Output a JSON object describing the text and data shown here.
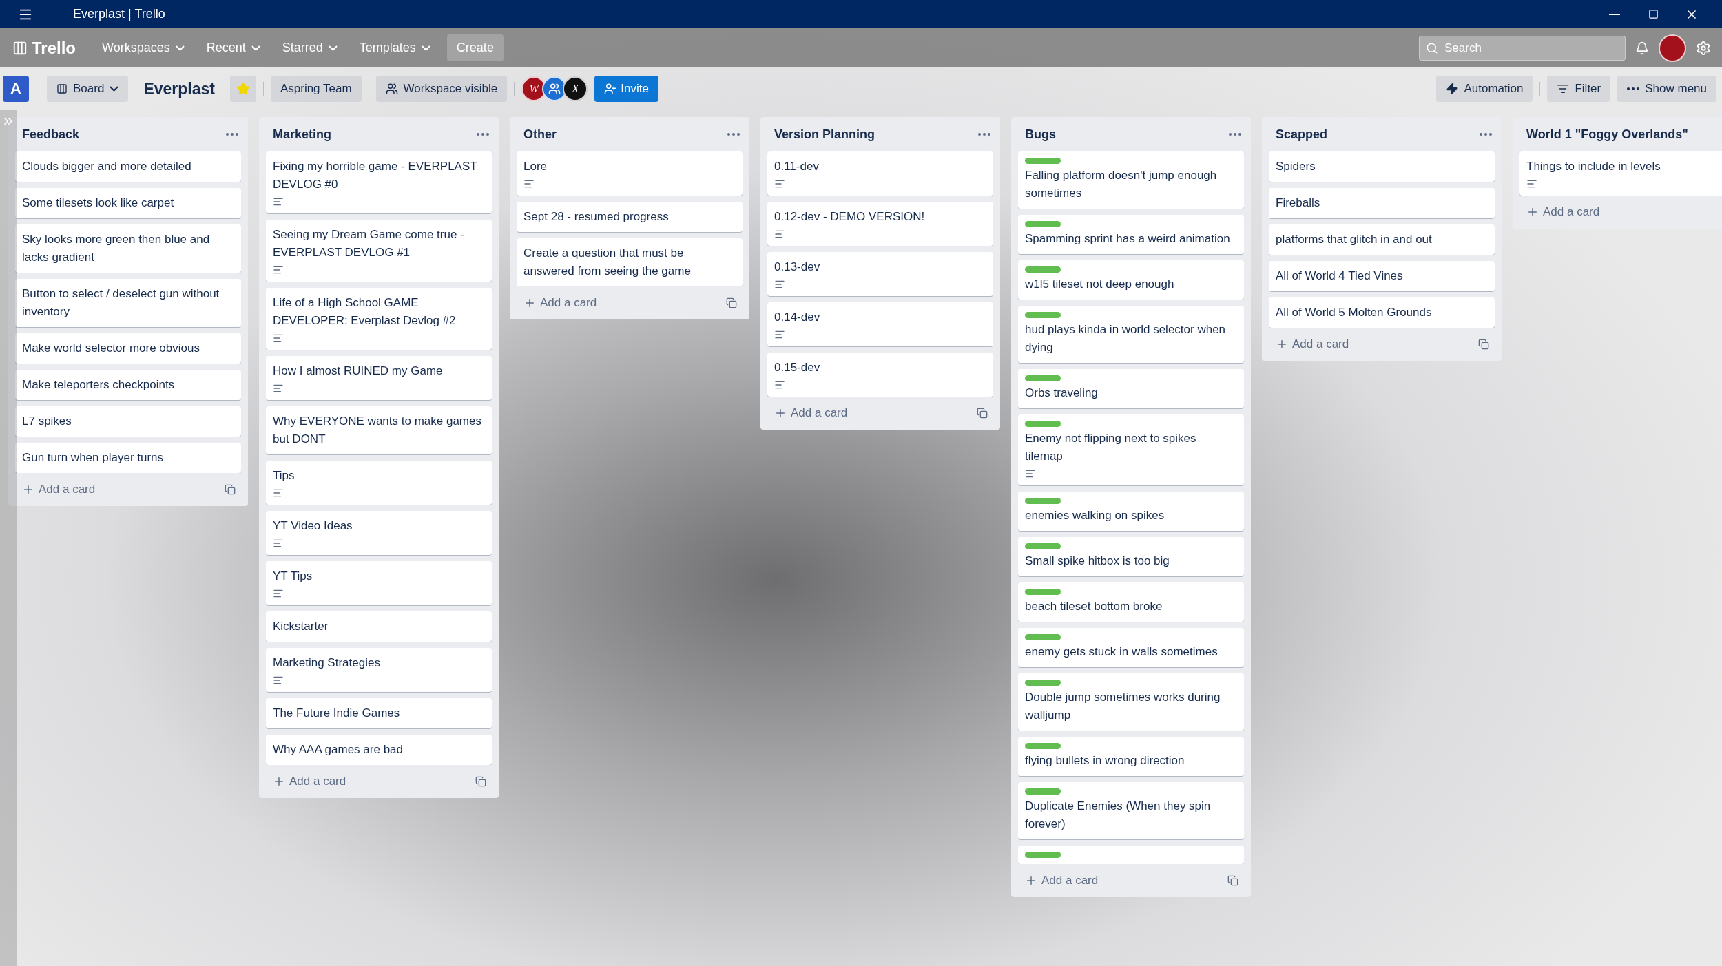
{
  "window": {
    "title": "Everplast | Trello"
  },
  "nav": {
    "brand": "Trello",
    "menus": [
      "Workspaces",
      "Recent",
      "Starred",
      "Templates"
    ],
    "create": "Create",
    "search": {
      "placeholder": "Search"
    }
  },
  "board_header": {
    "workspace_letter": "A",
    "view": "Board",
    "title": "Everplast",
    "starred": true,
    "team": "Aspring Team",
    "visibility": "Workspace visible",
    "members": [
      {
        "color": "#a3121c",
        "initial": "W"
      },
      {
        "color": "#1f6fd1"
      },
      {
        "color": "#111111",
        "initial": "X"
      }
    ],
    "invite": "Invite",
    "automation": "Automation",
    "filter": "Filter",
    "show_menu": "Show menu"
  },
  "lists": [
    {
      "title": "Feedback",
      "menu": true,
      "add_card": "Add a card",
      "template": true,
      "cards": [
        {
          "title": "Clouds bigger and more detailed",
          "label": false,
          "description": false
        },
        {
          "title": "Some tilesets look like carpet",
          "label": false,
          "description": false
        },
        {
          "title": "Sky looks more green then blue and lacks gradient",
          "label": false,
          "description": false
        },
        {
          "title": "Button to select / deselect gun without inventory",
          "label": false,
          "description": false
        },
        {
          "title": "Make world selector more obvious",
          "label": false,
          "description": false
        },
        {
          "title": "Make teleporters checkpoints",
          "label": false,
          "description": false
        },
        {
          "title": "L7 spikes",
          "label": false,
          "description": false
        },
        {
          "title": "Gun turn when player turns",
          "label": false,
          "description": false
        }
      ]
    },
    {
      "title": "Marketing",
      "menu": true,
      "add_card": "Add a card",
      "template": true,
      "cards": [
        {
          "title": "Fixing my horrible game - EVERPLAST DEVLOG #0",
          "label": false,
          "description": true
        },
        {
          "title": "Seeing my Dream Game come true - EVERPLAST DEVLOG #1",
          "label": false,
          "description": true
        },
        {
          "title": "Life of a High School GAME DEVELOPER: Everplast Devlog #2",
          "label": false,
          "description": true
        },
        {
          "title": "How I almost RUINED my Game",
          "label": false,
          "description": true
        },
        {
          "title": "Why EVERYONE wants to make games but DONT",
          "label": false,
          "description": false
        },
        {
          "title": "Tips",
          "label": false,
          "description": true
        },
        {
          "title": "YT Video Ideas",
          "label": false,
          "description": true
        },
        {
          "title": "YT Tips",
          "label": false,
          "description": true
        },
        {
          "title": "Kickstarter",
          "label": false,
          "description": false
        },
        {
          "title": "Marketing Strategies",
          "label": false,
          "description": true
        },
        {
          "title": "The Future Indie Games",
          "label": false,
          "description": false
        },
        {
          "title": "Why AAA games are bad",
          "label": false,
          "description": false
        }
      ]
    },
    {
      "title": "Other",
      "menu": true,
      "add_card": "Add a card",
      "template": true,
      "cards": [
        {
          "title": "Lore",
          "label": false,
          "description": true
        },
        {
          "title": "Sept 28 - resumed progress",
          "label": false,
          "description": false
        },
        {
          "title": "Create a question that must be answered from seeing the game",
          "label": false,
          "description": false
        }
      ]
    },
    {
      "title": "Version Planning",
      "menu": true,
      "add_card": "Add a card",
      "template": true,
      "cards": [
        {
          "title": "0.11-dev",
          "label": false,
          "description": true
        },
        {
          "title": "0.12-dev - DEMO VERSION!",
          "label": false,
          "description": true
        },
        {
          "title": "0.13-dev",
          "label": false,
          "description": true
        },
        {
          "title": "0.14-dev",
          "label": false,
          "description": true
        },
        {
          "title": "0.15-dev",
          "label": false,
          "description": true
        }
      ]
    },
    {
      "title": "Bugs",
      "menu": true,
      "add_card": "Add a card",
      "template": true,
      "cards": [
        {
          "title": "Falling platform doesn't jump enough sometimes",
          "label": true,
          "description": false
        },
        {
          "title": "Spamming sprint has a weird animation",
          "label": true,
          "description": false
        },
        {
          "title": "w1l5 tileset not deep enough",
          "label": true,
          "description": false
        },
        {
          "title": "hud plays kinda in world selector when dying",
          "label": true,
          "description": false
        },
        {
          "title": "Orbs traveling",
          "label": true,
          "description": false
        },
        {
          "title": "Enemy not flipping next to spikes tilemap",
          "label": true,
          "description": true
        },
        {
          "title": "enemies walking on spikes",
          "label": true,
          "description": false
        },
        {
          "title": "Small spike hitbox is too big",
          "label": true,
          "description": false
        },
        {
          "title": "beach tileset bottom broke",
          "label": true,
          "description": false
        },
        {
          "title": "enemy gets stuck in walls sometimes",
          "label": true,
          "description": false
        },
        {
          "title": "Double jump sometimes works during walljump",
          "label": true,
          "description": false
        },
        {
          "title": "flying bullets in wrong direction",
          "label": true,
          "description": false
        },
        {
          "title": "Duplicate Enemies (When they spin forever)",
          "label": true,
          "description": false
        },
        {
          "label": true,
          "description": false
        }
      ]
    },
    {
      "title": "Scapped",
      "menu": true,
      "add_card": "Add a card",
      "template": true,
      "cards": [
        {
          "title": "Spiders",
          "label": false,
          "description": false
        },
        {
          "title": "Fireballs",
          "label": false,
          "description": false
        },
        {
          "title": "platforms that glitch in and out",
          "label": false,
          "description": false
        },
        {
          "title": "All of World 4 Tied Vines",
          "label": false,
          "description": false
        },
        {
          "title": "All of World 5 Molten Grounds",
          "label": false,
          "description": false
        }
      ]
    },
    {
      "title": "World 1 \"Foggy Overlands\"",
      "menu": false,
      "add_card": "Add a card",
      "template": false,
      "cards": [
        {
          "title": "Things to include in levels",
          "label": false,
          "description": true
        }
      ]
    }
  ]
}
